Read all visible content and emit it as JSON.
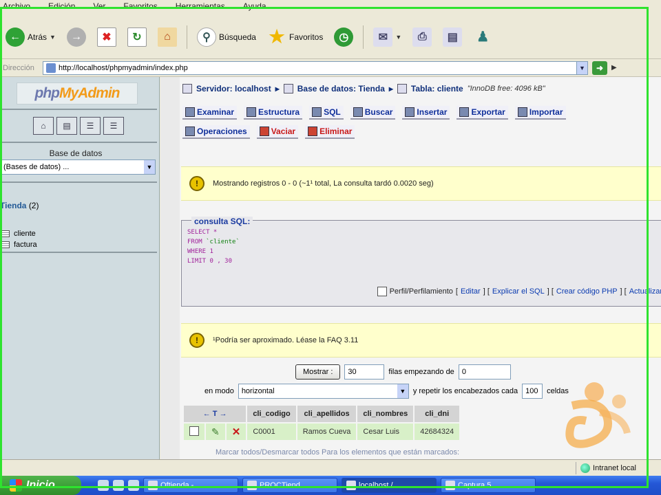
{
  "menu": [
    "Archivo",
    "Edición",
    "Ver",
    "Favoritos",
    "Herramientas",
    "Ayuda"
  ],
  "toolbar": {
    "back": "Atrás",
    "search": "Búsqueda",
    "favorites": "Favoritos"
  },
  "address": {
    "label": "Dirección",
    "url": "http://localhost/phpmyadmin/index.php"
  },
  "sidebar": {
    "logo_php": "php",
    "logo_my": "My",
    "logo_admin": "Admin",
    "db_label": "Base de datos",
    "db_select": "(Bases de datos) ...",
    "db_name": "Tienda",
    "db_count": "(2)",
    "tables": [
      "cliente",
      "factura"
    ]
  },
  "breadcrumb": {
    "server": "Servidor: localhost",
    "database": "Base de datos: Tienda",
    "table": "Tabla: cliente",
    "note": "\"InnoDB free: 4096 kB\""
  },
  "tabs_row1": [
    "Examinar",
    "Estructura",
    "SQL",
    "Buscar",
    "Insertar",
    "Exportar",
    "Importar"
  ],
  "tabs_row2": [
    "Operaciones",
    "Vaciar",
    "Eliminar"
  ],
  "notice1": "Mostrando registros 0 - 0 (~1¹ total, La consulta tardó 0.0020 seg)",
  "sql": {
    "legend": "consulta SQL:",
    "line1": "SELECT *",
    "line2_kw": "FROM",
    "line2_str": "`cliente`",
    "line3": "WHERE 1",
    "line4": "LIMIT 0 , 30",
    "profiling": "Perfil/Perfilamiento",
    "edit": "Editar",
    "explain": "Explicar el SQL",
    "php": "Crear código PHP",
    "refresh": "Actualizar"
  },
  "notice2": "¹Podría ser aproximado. Léase la FAQ 3.11",
  "controls": {
    "show_button": "Mostrar :",
    "rows_value": "30",
    "rows_label": "filas empezando de",
    "start_value": "0",
    "mode_label": "en modo",
    "mode_value": "horizontal",
    "repeat_label": "y repetir los encabezados cada",
    "repeat_value": "100",
    "cells_label": "celdas"
  },
  "table": {
    "action_header": "← T →",
    "columns": [
      "cli_codigo",
      "cli_apellidos",
      "cli_nombres",
      "cli_dni"
    ],
    "rows": [
      [
        "C0001",
        "Ramos Cueva",
        "Cesar Luis",
        "42684324"
      ]
    ]
  },
  "faded_row": "Marcar todos/Desmarcar todos  Para los elementos que están marcados:",
  "status": {
    "zone": "Intranet local"
  },
  "taskbar": {
    "start": "Inicio",
    "tasks": [
      "Oftienda -",
      "PROCTiend...",
      "localhost /...",
      "Captura 5..."
    ]
  }
}
